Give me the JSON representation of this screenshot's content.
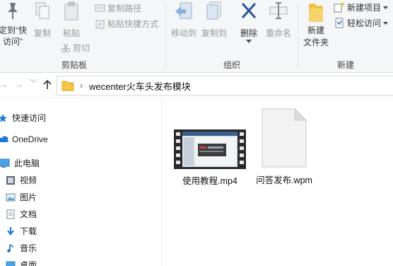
{
  "ribbon": {
    "clipboard": {
      "pin_label_line1": "定到“快",
      "pin_label_line2": "访问”",
      "copy_label": "复制",
      "paste_label": "粘贴",
      "copy_path_label": "复制路径",
      "paste_shortcut_label": "粘贴快捷方式",
      "cut_label": "剪切",
      "group_label": "剪贴板"
    },
    "organize": {
      "move_to_label": "移动到",
      "copy_to_label": "复制到",
      "delete_label": "删除",
      "rename_label": "重命名",
      "group_label": "组织"
    },
    "new": {
      "new_folder_line1": "新建",
      "new_folder_line2": "文件夹",
      "new_item_label": "新建项目",
      "easy_access_label": "轻松访问",
      "group_label": "新建"
    }
  },
  "address": {
    "path": "wecenter火车头发布模块"
  },
  "navpane": {
    "items": [
      {
        "label": "快速访问",
        "icon": "star-icon"
      },
      {
        "label": "OneDrive",
        "icon": "cloud-icon"
      },
      {
        "label": "此电脑",
        "icon": "computer-icon"
      },
      {
        "label": "视频",
        "icon": "video-icon"
      },
      {
        "label": "图片",
        "icon": "picture-icon"
      },
      {
        "label": "文档",
        "icon": "document-icon"
      },
      {
        "label": "下载",
        "icon": "download-icon"
      },
      {
        "label": "音乐",
        "icon": "music-icon"
      },
      {
        "label": "桌面",
        "icon": "desktop-icon"
      }
    ]
  },
  "files": [
    {
      "name": "使用教程.mp4",
      "icon": "video-file-icon"
    },
    {
      "name": "问答发布.wpm",
      "icon": "blank-file-icon"
    }
  ],
  "colors": {
    "ribbon_bg": "#f5f6f7",
    "accent_blue": "#1e78d7",
    "folder_yellow": "#f4c542",
    "delete_blue": "#2b5797"
  }
}
